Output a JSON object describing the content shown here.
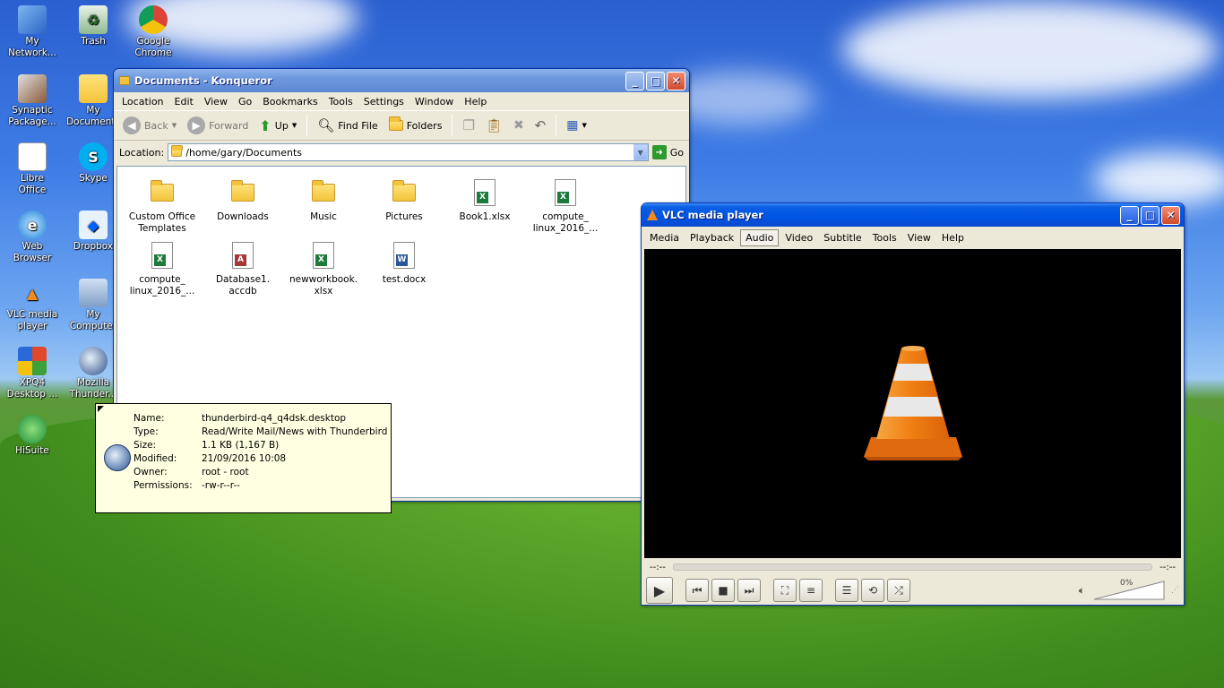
{
  "desktop": {
    "icons": [
      {
        "label": "My\nNetwork...",
        "icon": "network-icon"
      },
      {
        "label": "Trash",
        "icon": "trash-icon"
      },
      {
        "label": "Google\nChrome",
        "icon": "chrome-icon"
      },
      {
        "label": "Synaptic\nPackage...",
        "icon": "synaptic-icon"
      },
      {
        "label": "My\nDocuments",
        "icon": "documents-icon"
      },
      {
        "label": "Libre\nOffice",
        "icon": "libreoffice-icon"
      },
      {
        "label": "Skype",
        "icon": "skype-icon"
      },
      {
        "label": "Web\nBrowser",
        "icon": "ie-icon"
      },
      {
        "label": "Dropbox",
        "icon": "dropbox-icon"
      },
      {
        "label": "VLC media\nplayer",
        "icon": "vlc-icon"
      },
      {
        "label": "My\nComputer",
        "icon": "computer-icon"
      },
      {
        "label": "XPQ4\nDesktop ...",
        "icon": "xpq4-icon"
      },
      {
        "label": "Mozilla\nThunder...",
        "icon": "thunderbird-icon"
      },
      {
        "label": "HiSuite",
        "icon": "hisuite-icon"
      }
    ]
  },
  "konqueror": {
    "title": "Documents - Konqueror",
    "menu": [
      "Location",
      "Edit",
      "View",
      "Go",
      "Bookmarks",
      "Tools",
      "Settings",
      "Window",
      "Help"
    ],
    "toolbar": {
      "back": "Back",
      "forward": "Forward",
      "up": "Up",
      "find": "Find File",
      "folders": "Folders"
    },
    "location_label": "Location:",
    "location_value": "/home/gary/Documents",
    "go_label": "Go",
    "files": [
      {
        "name": "Custom Office\nTemplates",
        "kind": "folder"
      },
      {
        "name": "Downloads",
        "kind": "folder"
      },
      {
        "name": "Music",
        "kind": "folder-music"
      },
      {
        "name": "Pictures",
        "kind": "folder-pictures"
      },
      {
        "name": "Book1.xlsx",
        "kind": "excel"
      },
      {
        "name": "compute_\nlinux_2016_...",
        "kind": "excel"
      },
      {
        "name": "compute_\nlinux_2016_...",
        "kind": "excel"
      },
      {
        "name": "Database1.\naccdb",
        "kind": "access"
      },
      {
        "name": "newworkbook.\nxlsx",
        "kind": "excel"
      },
      {
        "name": "test.docx",
        "kind": "word"
      }
    ]
  },
  "tooltip": {
    "rows": [
      {
        "key": "Name:",
        "value": "thunderbird-q4_q4dsk.desktop"
      },
      {
        "key": "Type:",
        "value": "Read/Write Mail/News with Thunderbird"
      },
      {
        "key": "Size:",
        "value": "1.1 KB (1,167 B)"
      },
      {
        "key": "Modified:",
        "value": "21/09/2016 10:08"
      },
      {
        "key": "Owner:",
        "value": "root - root"
      },
      {
        "key": "Permissions:",
        "value": "-rw-r--r--"
      }
    ]
  },
  "vlc": {
    "title": "VLC media player",
    "menu": [
      "Media",
      "Playback",
      "Audio",
      "Video",
      "Subtitle",
      "Tools",
      "View",
      "Help"
    ],
    "active_menu": "Audio",
    "time_elapsed": "--:--",
    "time_total": "--:--",
    "volume": "0%"
  },
  "colors": {
    "xp_blue": "#0054e3",
    "tooltip_bg": "#ffffe1",
    "vlc_orange": "#f28a1c"
  }
}
